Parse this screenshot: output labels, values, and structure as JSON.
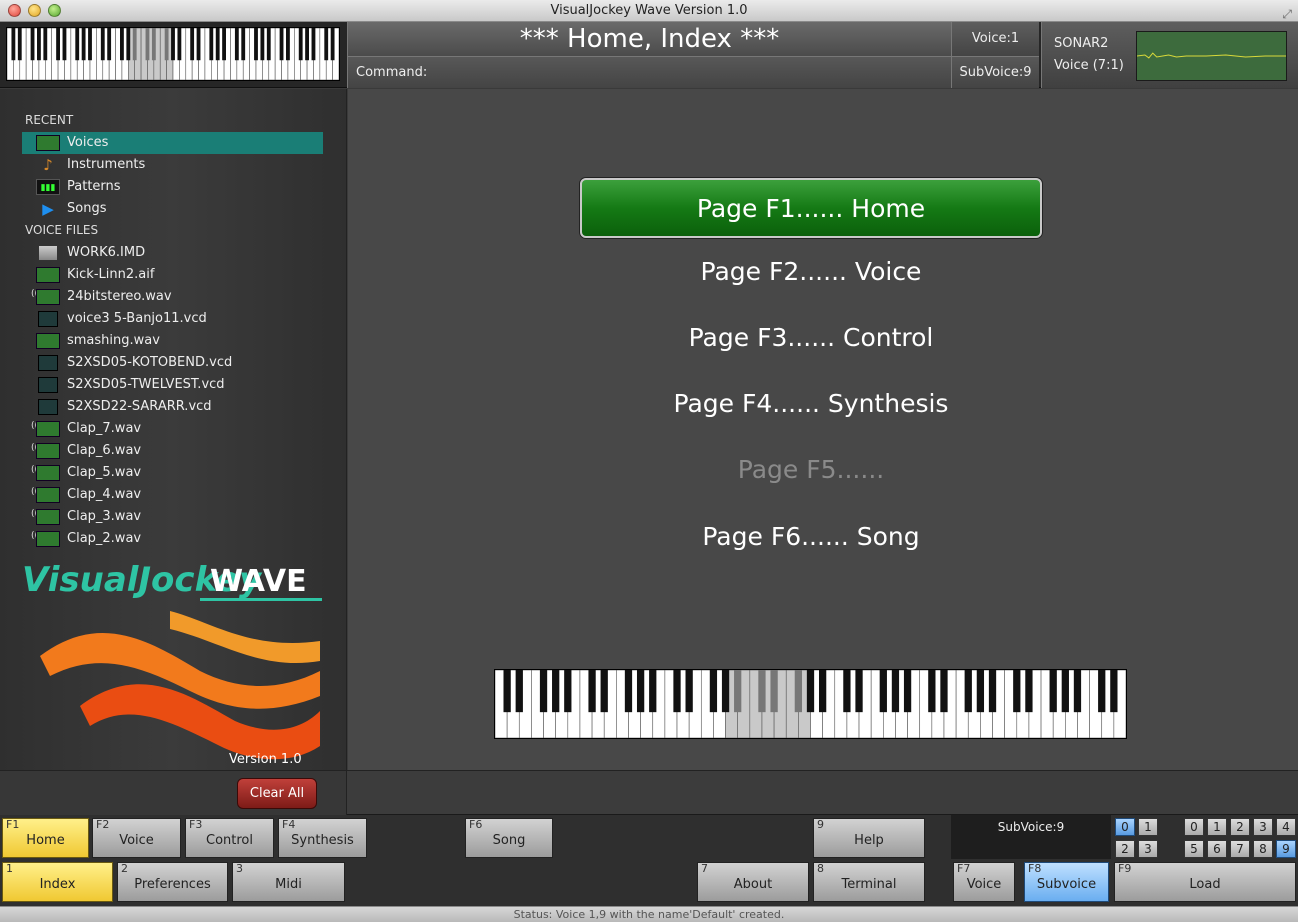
{
  "window": {
    "title": "VisualJockey Wave Version 1.0"
  },
  "header": {
    "title": "*** Home, Index ***",
    "command_label": "Command:",
    "voice": "Voice:1",
    "subvoice": "SubVoice:9",
    "sonar_name": "SONAR2",
    "sonar_voice": "Voice (7:1)"
  },
  "sidebar": {
    "recent_heading": "RECENT",
    "recent": [
      {
        "label": "Voices",
        "icon": "waveform-icon",
        "selected": true
      },
      {
        "label": "Instruments",
        "icon": "guitar-icon"
      },
      {
        "label": "Patterns",
        "icon": "pattern-icon"
      },
      {
        "label": "Songs",
        "icon": "play-icon"
      }
    ],
    "files_heading": "VOICE FILES",
    "files": [
      {
        "label": "WORK6.IMD",
        "icon": "disk-icon"
      },
      {
        "label": "Kick-Linn2.aif",
        "icon": "waveform-icon"
      },
      {
        "label": "24bitstereo.wav",
        "icon": "waveform-icon",
        "stereo": true
      },
      {
        "label": "voice3 5-Banjo11.vcd",
        "icon": "vcd-icon"
      },
      {
        "label": "smashing.wav",
        "icon": "waveform-icon"
      },
      {
        "label": "S2XSD05-KOTOBEND.vcd",
        "icon": "vcd-icon"
      },
      {
        "label": "S2XSD05-TWELVEST.vcd",
        "icon": "vcd-icon"
      },
      {
        "label": "S2XSD22-SARARR.vcd",
        "icon": "vcd-icon"
      },
      {
        "label": "Clap_7.wav",
        "icon": "waveform-icon",
        "stereo": true
      },
      {
        "label": "Clap_6.wav",
        "icon": "waveform-icon",
        "stereo": true
      },
      {
        "label": "Clap_5.wav",
        "icon": "waveform-icon",
        "stereo": true
      },
      {
        "label": "Clap_4.wav",
        "icon": "waveform-icon",
        "stereo": true
      },
      {
        "label": "Clap_3.wav",
        "icon": "waveform-icon",
        "stereo": true
      },
      {
        "label": "Clap_2.wav",
        "icon": "waveform-icon",
        "stereo": true
      }
    ],
    "logo_left": "VisualJockey",
    "logo_right": "WAVE",
    "version": "Version 1.0",
    "clear_all": "Clear All"
  },
  "pages": [
    {
      "label": "Page F1...... Home",
      "active": true
    },
    {
      "label": "Page F2...... Voice"
    },
    {
      "label": "Page F3...... Control"
    },
    {
      "label": "Page F4...... Synthesis"
    },
    {
      "label": "Page F5......",
      "disabled": true
    },
    {
      "label": "Page F6...... Song"
    }
  ],
  "fkeys": {
    "f1": {
      "num": "F1",
      "label": "Home"
    },
    "f2": {
      "num": "F2",
      "label": "Voice"
    },
    "f3": {
      "num": "F3",
      "label": "Control"
    },
    "f4": {
      "num": "F4",
      "label": "Synthesis"
    },
    "f6": {
      "num": "F6",
      "label": "Song"
    },
    "k9": {
      "num": "9",
      "label": "Help"
    },
    "k1": {
      "num": "1",
      "label": "Index"
    },
    "k2": {
      "num": "2",
      "label": "Preferences"
    },
    "k3": {
      "num": "3",
      "label": "Midi"
    },
    "k7": {
      "num": "7",
      "label": "About"
    },
    "k8": {
      "num": "8",
      "label": "Terminal"
    },
    "f7": {
      "num": "F7",
      "label": "Voice"
    },
    "f8": {
      "num": "F8",
      "label": "Subvoice"
    },
    "f9": {
      "num": "F9",
      "label": "Load"
    }
  },
  "subvoice_panel": {
    "label": "SubVoice:9"
  },
  "numpad_left": [
    "0",
    "1",
    "2",
    "3"
  ],
  "numpad_right": [
    "0",
    "1",
    "2",
    "3",
    "4",
    "5",
    "6",
    "7",
    "8",
    "9"
  ],
  "status": "Status: Voice 1,9 with the name'Default' created.",
  "colors": {
    "accent_green": "#157a15",
    "selection": "#1a7e76",
    "fkey_active": "#f0c832",
    "fkey_blue": "#6aaef0"
  }
}
